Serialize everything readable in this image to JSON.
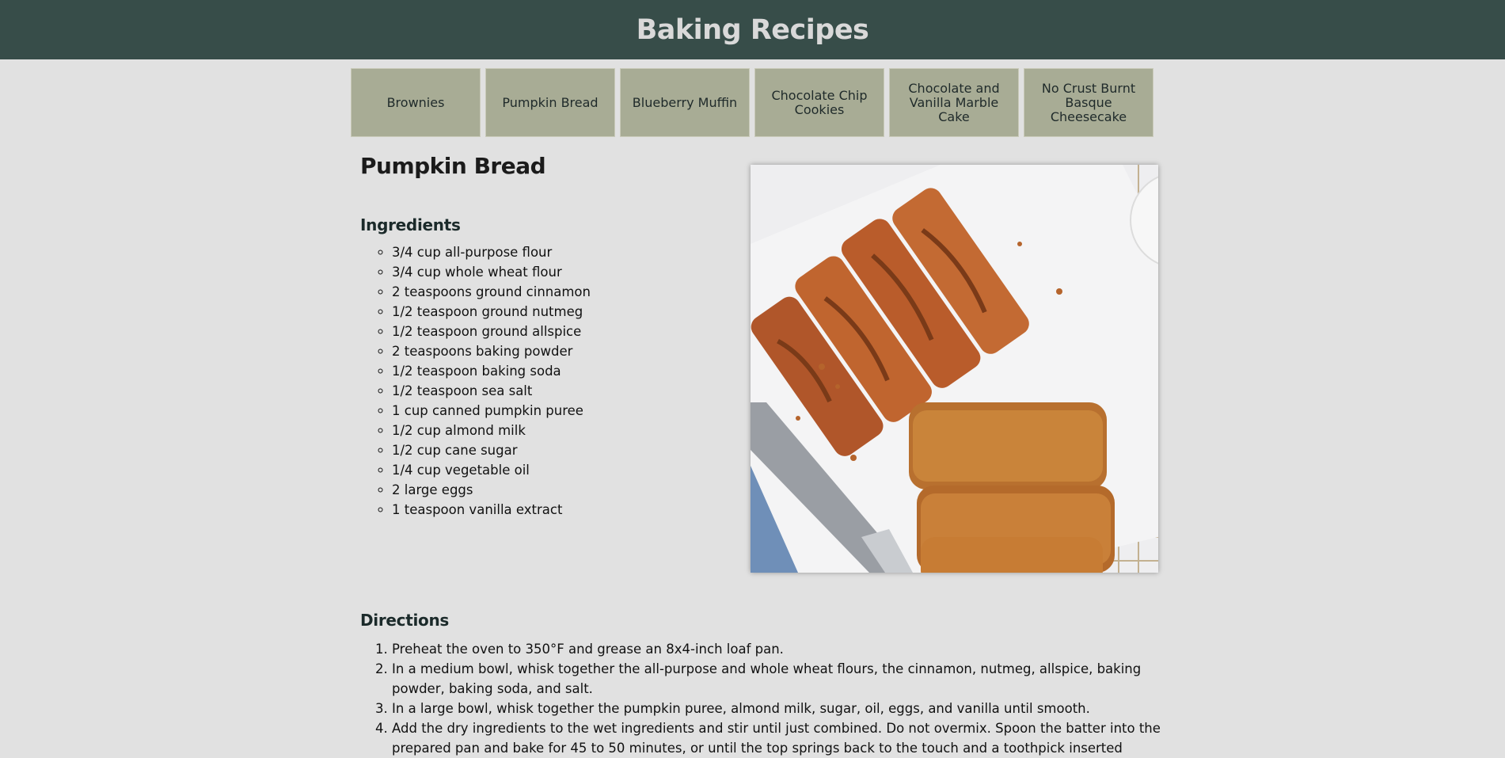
{
  "site": {
    "title": "Baking Recipes"
  },
  "nav": {
    "items": [
      "Brownies",
      "Pumpkin Bread",
      "Blueberry Muffin",
      "Chocolate Chip Cookies",
      "Chocolate and Vanilla Marble Cake",
      "No Crust Burnt Basque Cheesecake"
    ]
  },
  "recipe": {
    "title": "Pumpkin Bread",
    "ingredients_heading": "Ingredients",
    "ingredients": [
      "3/4 cup all-purpose flour",
      "3/4 cup whole wheat flour",
      "2 teaspoons ground cinnamon",
      "1/2 teaspoon ground nutmeg",
      "1/2 teaspoon ground allspice",
      "2 teaspoons baking powder",
      "1/2 teaspoon baking soda",
      "1/2 teaspoon sea salt",
      "1 cup canned pumpkin puree",
      "1/2 cup almond milk",
      "1/2 cup cane sugar",
      "1/4 cup vegetable oil",
      "2 large eggs",
      "1 teaspoon vanilla extract"
    ],
    "directions_heading": "Directions",
    "directions": [
      "Preheat the oven to 350°F and grease an 8x4-inch loaf pan.",
      "In a medium bowl, whisk together the all-purpose and whole wheat flours, the cinnamon, nutmeg, allspice, baking powder, baking soda, and salt.",
      "In a large bowl, whisk together the pumpkin puree, almond milk, sugar, oil, eggs, and vanilla until smooth.",
      "Add the dry ingredients to the wet ingredients and stir until just combined. Do not overmix. Spoon the batter into the prepared pan and bake for 45 to 50 minutes, or until the top springs back to the touch and a toothpick inserted"
    ]
  },
  "colors": {
    "header_bg": "#374d49",
    "header_text": "#d9d9d9",
    "page_bg": "#e1e1e1",
    "nav_button_bg": "#a8ac95"
  }
}
